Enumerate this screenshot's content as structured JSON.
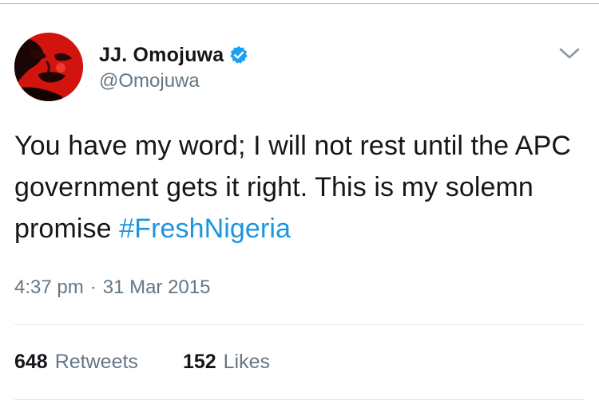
{
  "tweet": {
    "author": {
      "display_name": "JJ. Omojuwa",
      "handle": "@Omojuwa",
      "verified": true,
      "avatar_icon": "profile-photo"
    },
    "text_plain": "You have my word; I will not rest until the APC government gets it right. This is my solemn promise ",
    "hashtag": "#FreshNigeria",
    "time": "4:37 pm",
    "separator": "·",
    "date": "31 Mar 2015",
    "stats": {
      "retweets_count": "648",
      "retweets_label": "Retweets",
      "likes_count": "152",
      "likes_label": "Likes"
    }
  },
  "icons": {
    "verified": "verified-badge-icon",
    "more": "chevron-down-icon"
  },
  "colors": {
    "hashtag": "#1b95e0",
    "verified": "#1da1f2",
    "secondary_text": "#657786",
    "divider": "#e1e8ed"
  }
}
